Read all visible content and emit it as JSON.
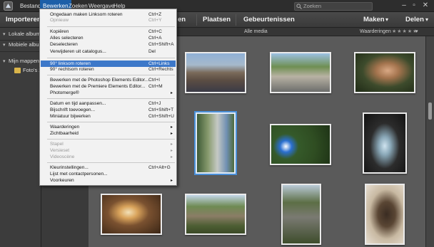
{
  "menubar": {
    "items": [
      "Bestand",
      "Bewerken",
      "Zoeken",
      "Weergave",
      "Help"
    ],
    "active_index": 1,
    "search_placeholder": "Zoeken"
  },
  "toolbar": {
    "import": "Importeren",
    "places": "Plaatsen",
    "events": "Gebeurtenissen",
    "create": "Maken",
    "share": "Delen",
    "hidden_tab": "en"
  },
  "left_panel": {
    "local_albums": "Lokale albums",
    "mobile_albums": "Mobiele albums",
    "my_folders": "Mijn mappen",
    "folder_item": "Foto's 2"
  },
  "strip": {
    "all_media": "Alle media",
    "ratings": "Waarderingen"
  },
  "edit_menu": {
    "items": [
      {
        "label": "Ongedaan maken Linksom roteren",
        "shortcut": "Ctrl+Z",
        "disabled": false
      },
      {
        "label": "Opnieuw",
        "shortcut": "Ctrl+Y",
        "disabled": true
      },
      {
        "label": "Kopiëren",
        "shortcut": "Ctrl+C",
        "disabled": false
      },
      {
        "label": "Alles selecteren",
        "shortcut": "Ctrl+A",
        "disabled": false
      },
      {
        "label": "Deselecteren",
        "shortcut": "Ctrl+Shift+A",
        "disabled": false
      },
      {
        "label": "Verwijderen uit catalogus...",
        "shortcut": "Del",
        "disabled": false
      },
      {
        "label": "90° linksom roteren",
        "shortcut": "Ctrl+Links",
        "disabled": false,
        "highlighted": true
      },
      {
        "label": "90° rechtsom roteren",
        "shortcut": "Ctrl+Rechts",
        "disabled": false
      },
      {
        "label": "Bewerken met de Photoshop Elements Editor...",
        "shortcut": "Ctrl+I",
        "disabled": false
      },
      {
        "label": "Bewerken met de Premiere Elements Editor...",
        "shortcut": "Ctrl+M",
        "disabled": false
      },
      {
        "label": "Photomerge®",
        "shortcut": "",
        "disabled": false,
        "submenu": true
      },
      {
        "label": "Datum en tijd aanpassen...",
        "shortcut": "Ctrl+J",
        "disabled": false
      },
      {
        "label": "Bijschrift toevoegen...",
        "shortcut": "Ctrl+Shift+T",
        "disabled": false
      },
      {
        "label": "Miniatuur bijwerken",
        "shortcut": "Ctrl+Shift+U",
        "disabled": false
      },
      {
        "label": "Waarderingen",
        "shortcut": "",
        "disabled": false,
        "submenu": true
      },
      {
        "label": "Zichtbaarheid",
        "shortcut": "",
        "disabled": false,
        "submenu": true
      },
      {
        "label": "Stapel",
        "shortcut": "",
        "disabled": true,
        "submenu": true
      },
      {
        "label": "Versieset",
        "shortcut": "",
        "disabled": true,
        "submenu": true
      },
      {
        "label": "Videoscène",
        "shortcut": "",
        "disabled": true,
        "submenu": true
      },
      {
        "label": "Kleurinstellingen...",
        "shortcut": "Ctrl+Alt+G",
        "disabled": false
      },
      {
        "label": "Lijst met contactpersonen...",
        "shortcut": "",
        "disabled": false
      },
      {
        "label": "Voorkeuren",
        "shortcut": "",
        "disabled": false,
        "submenu": true
      }
    ]
  },
  "colors": {
    "menu_highlight": "#3d78c9",
    "active_menu": "#1d5fa8",
    "grid_background": "#5a5a5a",
    "selection_outline": "#4a90d9"
  }
}
